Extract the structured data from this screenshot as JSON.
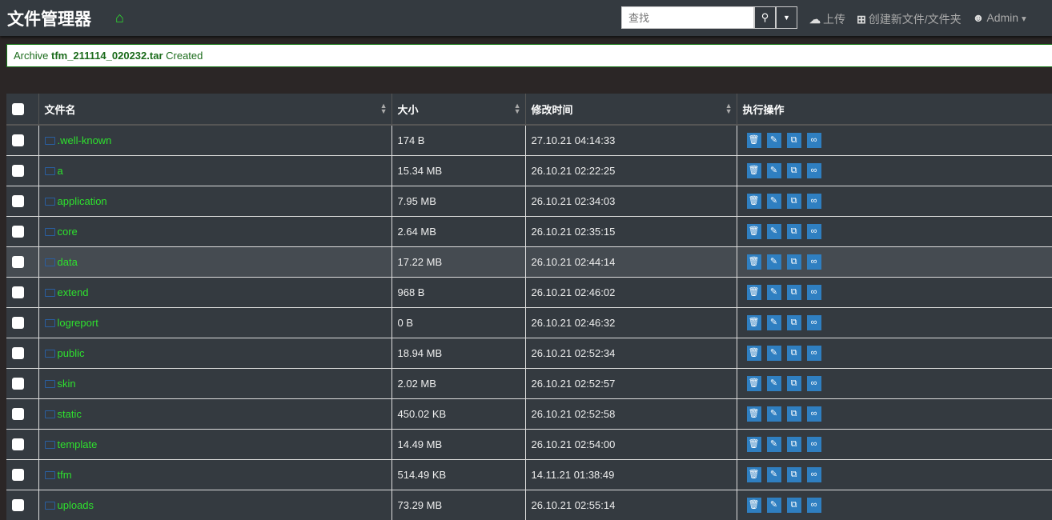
{
  "header": {
    "title": "文件管理器",
    "search_placeholder": "查找",
    "upload": "上传",
    "new": "创建新文件/文件夹",
    "user": "Admin"
  },
  "alert": {
    "prefix": "Archive",
    "file": "tfm_211114_020232.tar",
    "suffix": "Created"
  },
  "table": {
    "headers": [
      "文件名",
      "大小",
      "修改时间",
      "执行操作"
    ],
    "rows": [
      {
        "name": ".well-known",
        "size": "174 B",
        "modified": "27.10.21 04:14:33"
      },
      {
        "name": "a",
        "size": "15.34 MB",
        "modified": "26.10.21 02:22:25"
      },
      {
        "name": "application",
        "size": "7.95 MB",
        "modified": "26.10.21 02:34:03"
      },
      {
        "name": "core",
        "size": "2.64 MB",
        "modified": "26.10.21 02:35:15"
      },
      {
        "name": "data",
        "size": "17.22 MB",
        "modified": "26.10.21 02:44:14"
      },
      {
        "name": "extend",
        "size": "968 B",
        "modified": "26.10.21 02:46:02"
      },
      {
        "name": "logreport",
        "size": "0 B",
        "modified": "26.10.21 02:46:32"
      },
      {
        "name": "public",
        "size": "18.94 MB",
        "modified": "26.10.21 02:52:34"
      },
      {
        "name": "skin",
        "size": "2.02 MB",
        "modified": "26.10.21 02:52:57"
      },
      {
        "name": "static",
        "size": "450.02 KB",
        "modified": "26.10.21 02:52:58"
      },
      {
        "name": "template",
        "size": "14.49 MB",
        "modified": "26.10.21 02:54:00"
      },
      {
        "name": "tfm",
        "size": "514.49 KB",
        "modified": "14.11.21 01:38:49"
      },
      {
        "name": "uploads",
        "size": "73.29 MB",
        "modified": "26.10.21 02:55:14"
      }
    ]
  }
}
